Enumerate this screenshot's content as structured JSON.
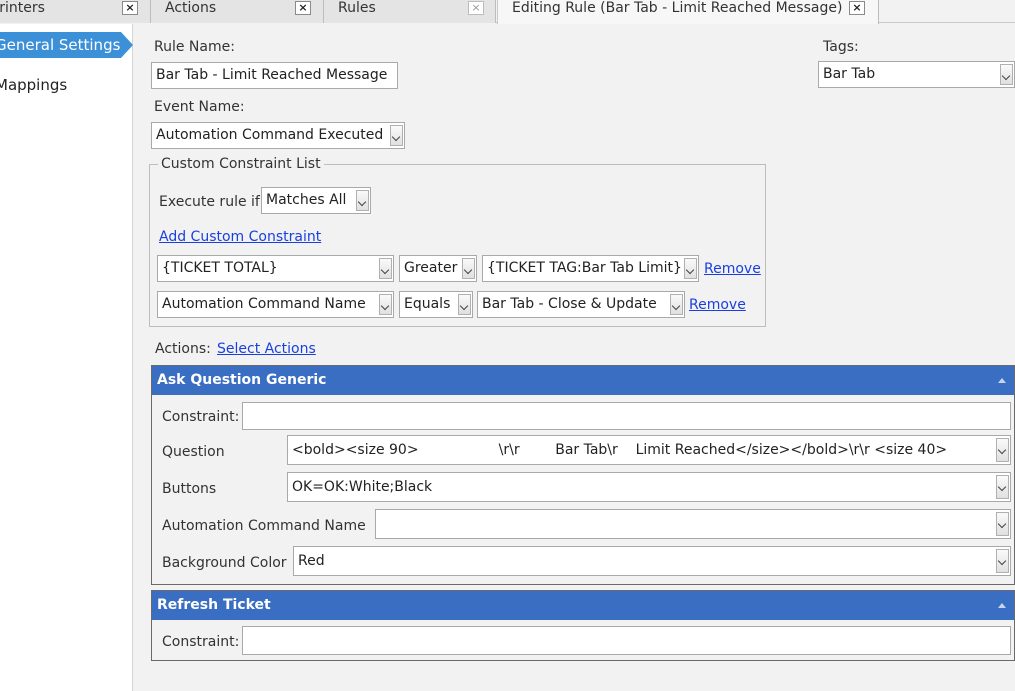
{
  "tabs": [
    {
      "label": "Printers"
    },
    {
      "label": "Actions"
    },
    {
      "label": "Rules"
    },
    {
      "label": "Editing Rule (Bar Tab - Limit Reached Message)"
    }
  ],
  "sidebar": {
    "items": [
      {
        "label": "General Settings"
      },
      {
        "label": "Mappings"
      }
    ]
  },
  "form": {
    "rule_name_label": "Rule Name:",
    "rule_name_value": "Bar Tab - Limit Reached Message",
    "tags_label": "Tags:",
    "tags_value": "Bar Tab",
    "event_name_label": "Event Name:",
    "event_name_value": "Automation Command Executed"
  },
  "constraints": {
    "group_label": "Custom Constraint List",
    "execute_label": "Execute rule if",
    "execute_value": "Matches All",
    "add_link": "Add Custom Constraint",
    "rows": [
      {
        "field": "{TICKET TOTAL}",
        "operator": "Greater",
        "value": "{TICKET TAG:Bar Tab Limit}",
        "remove": "Remove"
      },
      {
        "field": "Automation Command Name",
        "operator": "Equals",
        "value": "Bar Tab - Close & Update",
        "remove": "Remove"
      }
    ]
  },
  "actions": {
    "label": "Actions:",
    "select_link": "Select Actions",
    "ask_question": {
      "title": "Ask Question Generic",
      "constraint_label": "Constraint:",
      "constraint_value": "",
      "question_label": "Question",
      "question_value": "<bold><size 90>                  \\r\\r        Bar Tab\\r    Limit Reached</size></bold>\\r\\r <size 40>",
      "buttons_label": "Buttons",
      "buttons_value": "OK=OK:White;Black",
      "auto_cmd_label": "Automation Command Name",
      "auto_cmd_value": "",
      "bg_color_label": "Background Color",
      "bg_color_value": "Red"
    },
    "refresh_ticket": {
      "title": "Refresh Ticket",
      "constraint_label": "Constraint:",
      "constraint_value": ""
    }
  },
  "icons": {
    "tab_close": "×"
  },
  "colors": {
    "accent": "#3c90d8",
    "panel_header": "#3a6ec2",
    "link": "#1a3fe0"
  }
}
